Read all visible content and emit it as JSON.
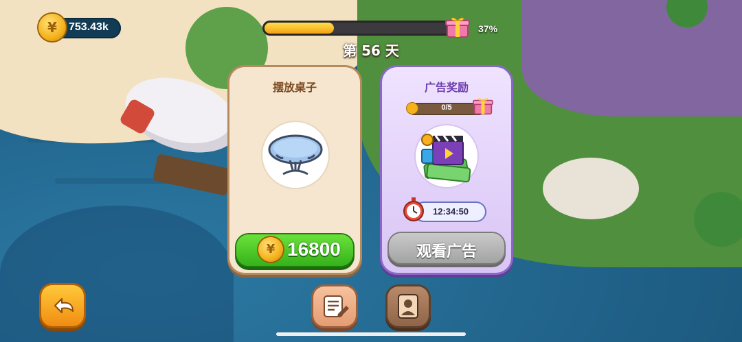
{
  "hud": {
    "coins": "753.43k",
    "day_progress_percent": 37,
    "day_progress_label": "37%",
    "day_label": "第 56 天"
  },
  "cards": {
    "place_table": {
      "title": "摆放桌子",
      "price": "16800",
      "icon": "round-table-icon"
    },
    "ad_reward": {
      "title": "广告奖励",
      "progress": "0/5",
      "progress_fraction": 0.0,
      "timer": "12:34:50",
      "button_label": "观看广告",
      "icon": "ad-reward-icon"
    }
  },
  "bottom_bar": {
    "back_icon": "back-arrow-icon",
    "note_icon": "note-pencil-icon",
    "portrait_icon": "portrait-frame-icon"
  },
  "colors": {
    "buy_green": "#35b21b",
    "ad_gray": "#a3a3a3",
    "coin_gold": "#f5b21c",
    "card_purple": "#8b67c8"
  }
}
